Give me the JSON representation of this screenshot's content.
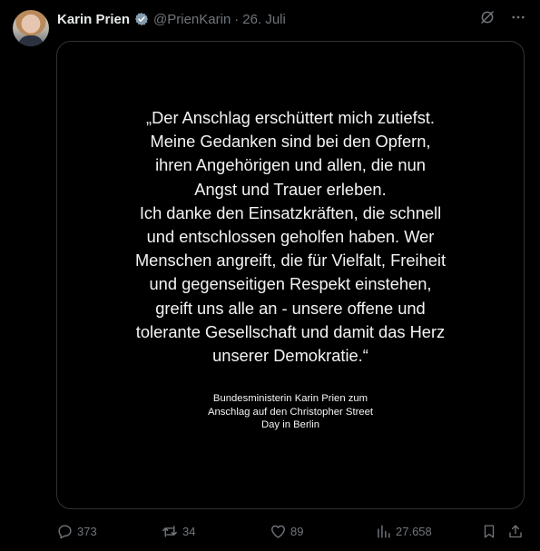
{
  "post": {
    "author_name": "Karin Prien",
    "handle": "@PrienKarin",
    "separator": "·",
    "date": "26. Juli",
    "image_quote": "„Der Anschlag erschüttert mich zutiefst.\nMeine Gedanken sind bei den Opfern,\nihren Angehörigen und allen, die nun\nAngst und Trauer erleben.\nIch danke den Einsatzkräften, die schnell\nund entschlossen geholfen haben. Wer\nMenschen angreift, die für Vielfalt, Freiheit\nund gegenseitigen Respekt einstehen,\ngreift uns alle an - unsere offene und\ntolerante Gesellschaft und damit das Herz\nunserer Demokratie.“",
    "image_caption": "Bundesministerin Karin Prien zum\nAnschlag auf den Christopher Street\nDay in Berlin"
  },
  "actions": {
    "replies": "373",
    "reposts": "34",
    "likes": "89",
    "views": "27.658"
  },
  "icons": {
    "verified": "verified-badge-icon",
    "grok": "grok-icon",
    "more": "more-icon",
    "reply": "reply-icon",
    "repost": "repost-icon",
    "like": "heart-icon",
    "views": "views-icon",
    "bookmark": "bookmark-icon",
    "share": "share-icon"
  },
  "colors": {
    "background": "#000000",
    "primary_text": "#e7e9ea",
    "secondary_text": "#71767b",
    "border": "#2f3336",
    "verified_badge": "#829aab"
  }
}
